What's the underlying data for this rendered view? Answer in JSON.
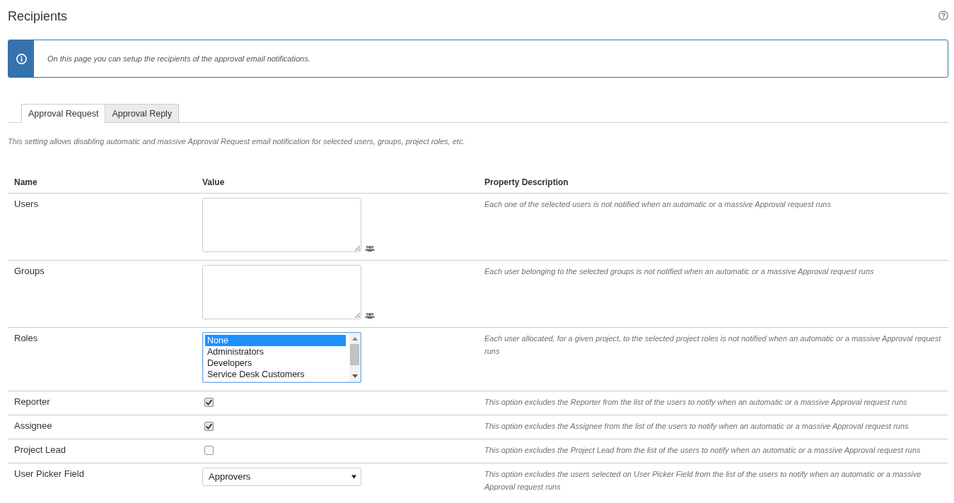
{
  "page": {
    "title": "Recipients"
  },
  "info_message": {
    "text": "On this page you can setup the recipients of the approval email notifications."
  },
  "tabs": [
    {
      "label": "Approval Request",
      "selected": true
    },
    {
      "label": "Approval Reply",
      "selected": false
    }
  ],
  "tab_description": "This setting allows disabling automatic and massive Approval Request email notification for selected users, groups, project roles, etc.",
  "table": {
    "columns": [
      "Name",
      "Value",
      "Property Description"
    ],
    "rows": [
      {
        "name": "Users",
        "kind": "textarea",
        "description": "Each one of the selected users is not notified when an automatic or a massive Approval request runs"
      },
      {
        "name": "Groups",
        "kind": "textarea",
        "description": "Each user belonging to the selected groups is not notified when an automatic or a massive Approval request runs"
      },
      {
        "name": "Roles",
        "kind": "listbox",
        "options": [
          {
            "label": "None",
            "selected": true
          },
          {
            "label": "Administrators",
            "selected": false
          },
          {
            "label": "Developers",
            "selected": false
          },
          {
            "label": "Service Desk Customers",
            "selected": false
          }
        ],
        "description": "Each user allocated, for a given project, to the selected project roles is not notified when an automatic or a massive Approval request runs"
      },
      {
        "name": "Reporter",
        "kind": "checkbox",
        "checked": true,
        "description": "This option excludes the Reporter from the list of the users to notify when an automatic or a massive Approval request runs"
      },
      {
        "name": "Assignee",
        "kind": "checkbox",
        "checked": true,
        "description": "This option excludes the Assignee from the list of the users to notify when an automatic or a massive Approval request runs"
      },
      {
        "name": "Project Lead",
        "kind": "checkbox",
        "checked": false,
        "description": "This option excludes the Project Lead from the list of the users to notify when an automatic or a massive Approval request runs"
      },
      {
        "name": "User Picker Field",
        "kind": "select",
        "value": "Approvers",
        "description": "This option excludes the users selected on User Picker Field from the list of the users to notify when an automatic or a massive Approval request runs"
      }
    ]
  }
}
